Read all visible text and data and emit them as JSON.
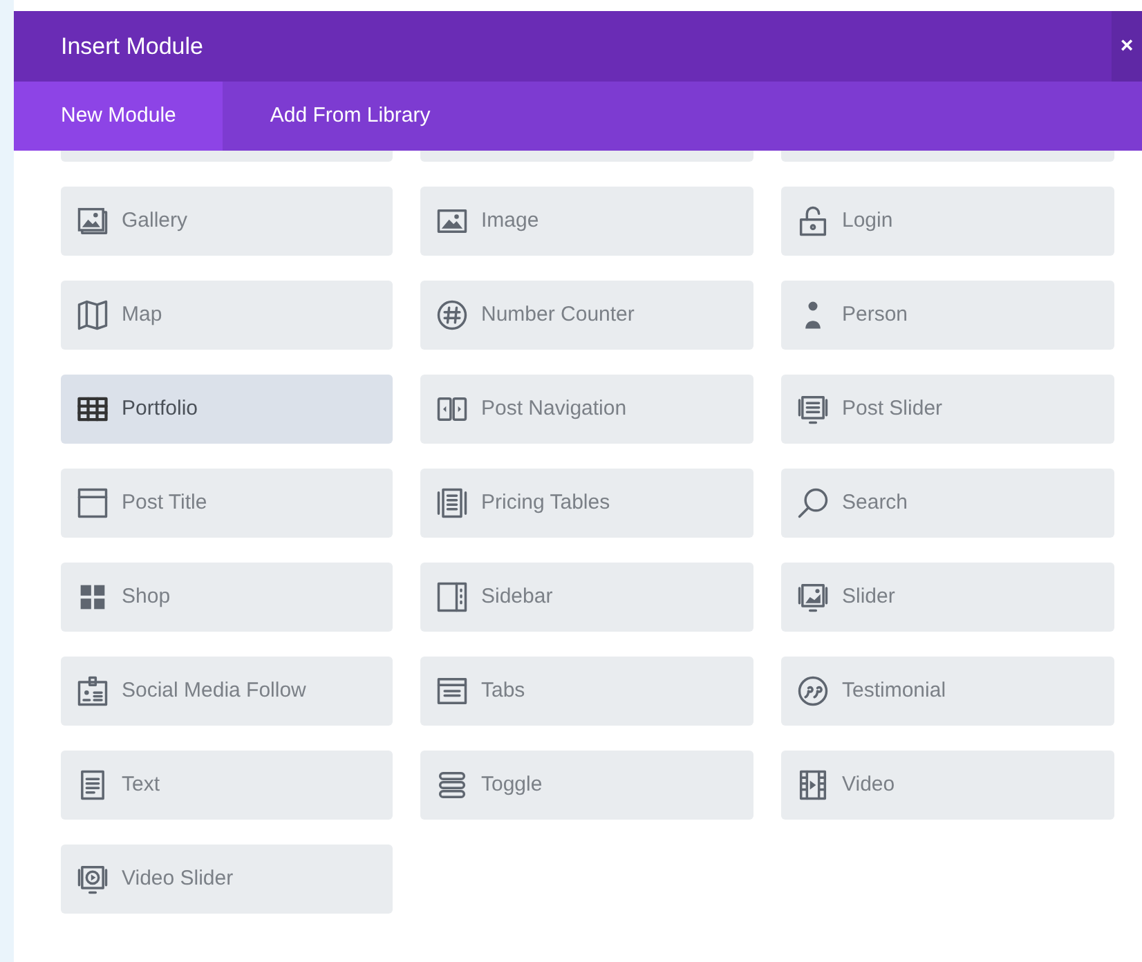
{
  "window": {
    "title": "Insert Module",
    "close": "×"
  },
  "tabs": [
    {
      "label": "New Module",
      "selected": true
    },
    {
      "label": "Add From Library",
      "selected": false
    }
  ],
  "modules": [
    {
      "label": "Gallery",
      "highlighted": false
    },
    {
      "label": "Image",
      "highlighted": false
    },
    {
      "label": "Login",
      "highlighted": false
    },
    {
      "label": "Map",
      "highlighted": false
    },
    {
      "label": "Number Counter",
      "highlighted": false
    },
    {
      "label": "Person",
      "highlighted": false
    },
    {
      "label": "Portfolio",
      "highlighted": true
    },
    {
      "label": "Post Navigation",
      "highlighted": false
    },
    {
      "label": "Post Slider",
      "highlighted": false
    },
    {
      "label": "Post Title",
      "highlighted": false
    },
    {
      "label": "Pricing Tables",
      "highlighted": false
    },
    {
      "label": "Search",
      "highlighted": false
    },
    {
      "label": "Shop",
      "highlighted": false
    },
    {
      "label": "Sidebar",
      "highlighted": false
    },
    {
      "label": "Slider",
      "highlighted": false
    },
    {
      "label": "Social Media Follow",
      "highlighted": false
    },
    {
      "label": "Tabs",
      "highlighted": false
    },
    {
      "label": "Testimonial",
      "highlighted": false
    },
    {
      "label": "Text",
      "highlighted": false
    },
    {
      "label": "Toggle",
      "highlighted": false
    },
    {
      "label": "Video",
      "highlighted": false
    },
    {
      "label": "Video Slider",
      "highlighted": false
    }
  ]
}
